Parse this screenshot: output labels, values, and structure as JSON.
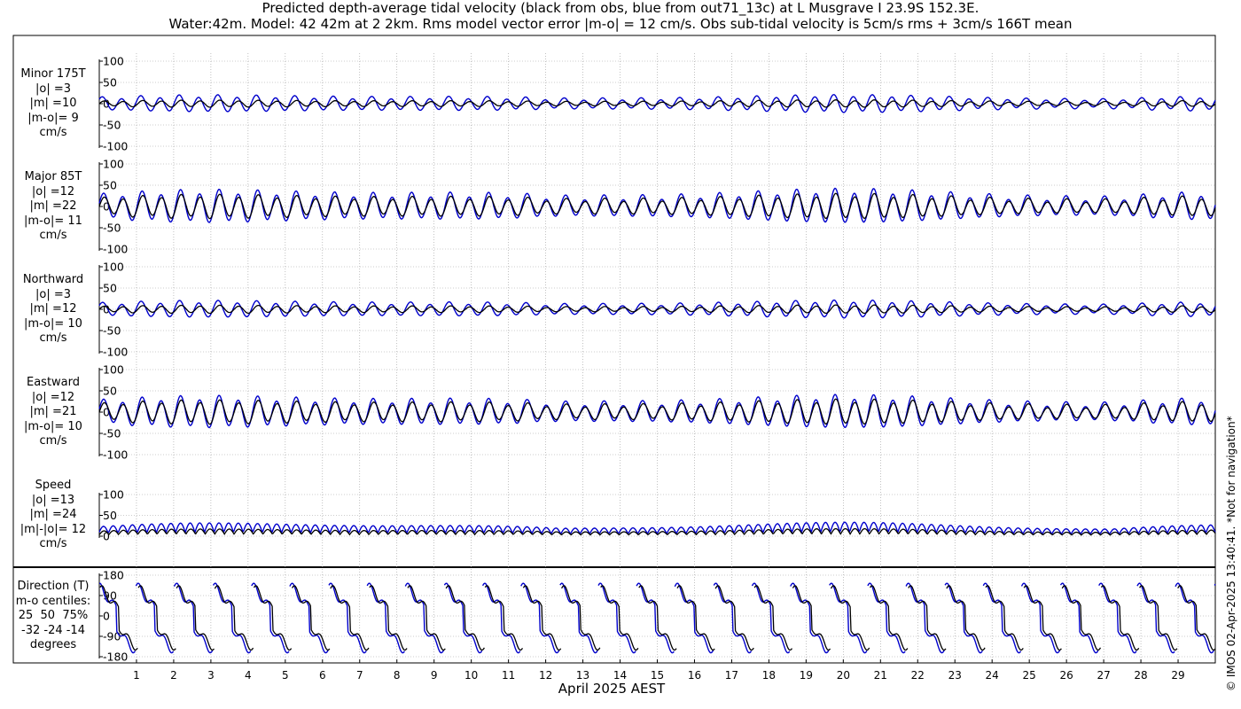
{
  "title_line1": "Predicted depth-average tidal velocity (black from obs, blue from out71_13c) at L Musgrave I 23.9S 152.3E.",
  "title_line2": "Water:42m. Model: 42 42m at 2 2km. Rms model vector error |m-o| = 12 cm/s. Obs sub-tidal velocity is 5cm/s rms + 3cm/s 166T mean",
  "copyright": "© IMOS 02-Apr-2025 13:40:41. *Not for navigation*",
  "colors": {
    "obs": "#000000",
    "model": "#0000cc",
    "grid": "#999999"
  },
  "chart_data": {
    "type": "line",
    "xlabel": "April 2025 AEST",
    "x_tick_labels": [
      "1",
      "2",
      "3",
      "4",
      "5",
      "6",
      "7",
      "8",
      "9",
      "10",
      "11",
      "12",
      "13",
      "14",
      "15",
      "16",
      "17",
      "18",
      "19",
      "20",
      "21",
      "22",
      "23",
      "24",
      "25",
      "26",
      "27",
      "28",
      "29"
    ],
    "xlim_days": [
      0,
      30
    ],
    "series_names": [
      "obs",
      "out71_13c"
    ],
    "panels": [
      {
        "id": "minor",
        "label_lines": [
          "Minor 175T",
          "|o| =3",
          "|m| =10",
          "|m-o|= 9",
          "cm/s"
        ],
        "ylim": [
          -100,
          100
        ],
        "yticks": [
          "100",
          "50",
          "0",
          "-50",
          "-100"
        ],
        "obs_amp": 7,
        "model_amp": 17,
        "model_phase": 0.6,
        "offset": 0,
        "signal": "wave"
      },
      {
        "id": "major",
        "label_lines": [
          "Major 85T",
          "|o| =12",
          "|m| =22",
          "|m-o|= 11",
          "cm/s"
        ],
        "ylim": [
          -100,
          100
        ],
        "yticks": [
          "100",
          "50",
          "0",
          "-50",
          "-100"
        ],
        "obs_amp": 24,
        "model_amp": 33,
        "model_phase": 0.2,
        "offset": 0,
        "signal": "wave"
      },
      {
        "id": "northward",
        "label_lines": [
          "Northward",
          "|o| =3",
          "|m| =12",
          "|m-o|= 10",
          "cm/s"
        ],
        "ylim": [
          -100,
          100
        ],
        "yticks": [
          "100",
          "50",
          "0",
          "-50",
          "-100"
        ],
        "obs_amp": 8,
        "model_amp": 17,
        "model_phase": 0.5,
        "offset": 0,
        "signal": "wave"
      },
      {
        "id": "eastward",
        "label_lines": [
          "Eastward",
          "|o| =12",
          "|m| =21",
          "|m-o|= 10",
          "cm/s"
        ],
        "ylim": [
          -100,
          100
        ],
        "yticks": [
          "100",
          "50",
          "0",
          "-50",
          "-100"
        ],
        "obs_amp": 24,
        "model_amp": 32,
        "model_phase": 0.2,
        "offset": 0,
        "signal": "wave"
      },
      {
        "id": "speed",
        "label_lines": [
          "Speed",
          "|o| =13",
          "|m| =24",
          "|m|-|o|= 12",
          "cm/s"
        ],
        "ylim": [
          0,
          100
        ],
        "yticks": [
          "100",
          "50",
          "0"
        ],
        "obs_amp": 13,
        "model_amp": 24,
        "model_phase": 0.2,
        "offset": 0,
        "signal": "speed"
      },
      {
        "id": "direction",
        "label_lines": [
          "Direction (T)",
          "m-o centiles:",
          "25  50  75%",
          "-32 -24 -14",
          "degrees"
        ],
        "ylim": [
          -180,
          180
        ],
        "yticks": [
          "180",
          "90",
          "0",
          "-90",
          "-180"
        ],
        "obs_amp": 1,
        "model_amp": 1,
        "model_phase": 0.35,
        "offset": 0,
        "signal": "direction"
      }
    ]
  }
}
